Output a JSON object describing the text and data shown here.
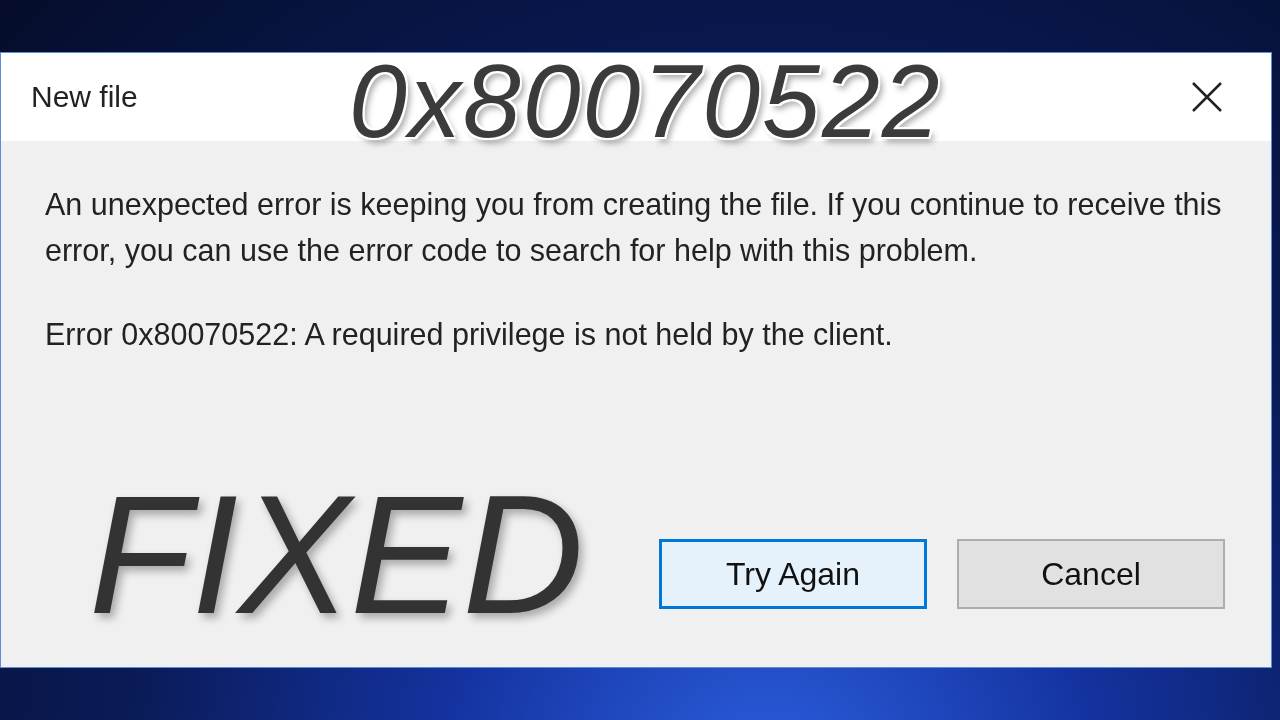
{
  "window": {
    "title": "New file"
  },
  "headline": "0x80070522",
  "message": [
    "An unexpected error is keeping you from creating the file. If you continue to receive this error, you can use the error code to search for help with this problem.",
    "Error 0x80070522: A required privilege is not held by the client."
  ],
  "banner": "FIXED",
  "buttons": [
    {
      "label": "Try Again",
      "focused": true
    },
    {
      "label": "Cancel",
      "focused": false
    }
  ]
}
